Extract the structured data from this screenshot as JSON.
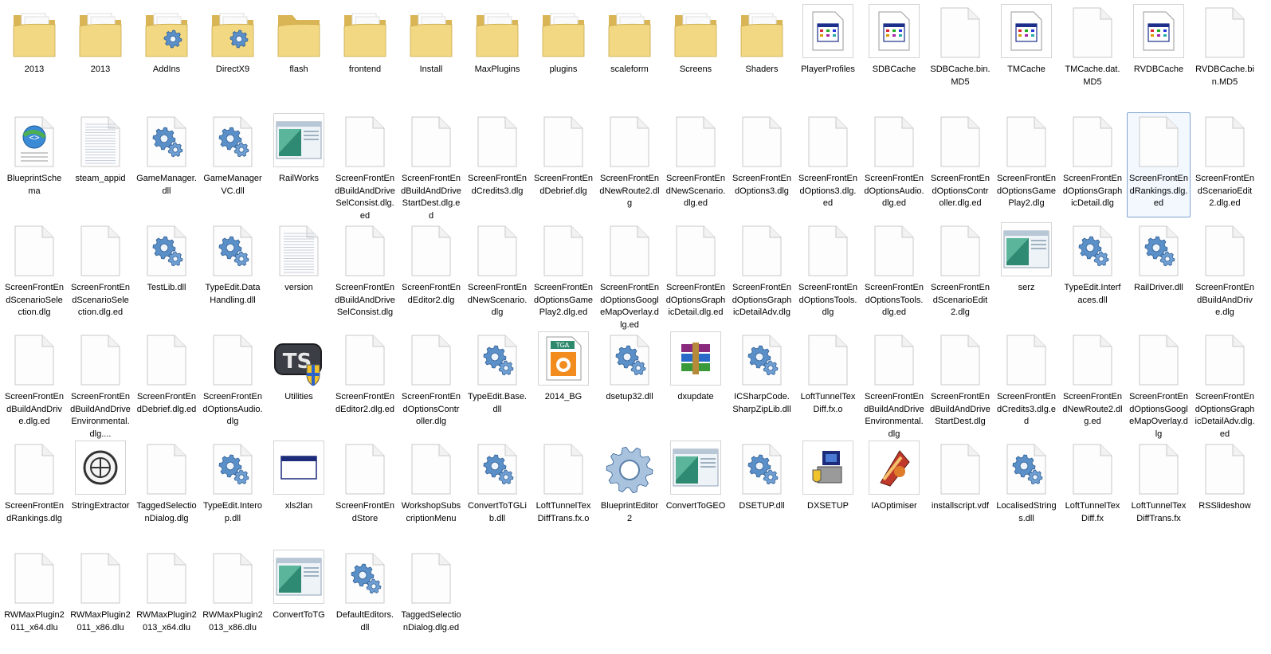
{
  "window": {
    "view": "large-icons"
  },
  "files": [
    {
      "name": "2013",
      "icon": "folder-icon"
    },
    {
      "name": "2013",
      "icon": "folder-icon"
    },
    {
      "name": "AddIns",
      "icon": "folder-gear-icon"
    },
    {
      "name": "DirectX9",
      "icon": "folder-gear-icon"
    },
    {
      "name": "flash",
      "icon": "folder-empty-icon"
    },
    {
      "name": "frontend",
      "icon": "folder-icon"
    },
    {
      "name": "Install",
      "icon": "folder-icon"
    },
    {
      "name": "MaxPlugins",
      "icon": "folder-icon"
    },
    {
      "name": "plugins",
      "icon": "folder-icon"
    },
    {
      "name": "scaleform",
      "icon": "folder-icon"
    },
    {
      "name": "Screens",
      "icon": "folder-icon"
    },
    {
      "name": "Shaders",
      "icon": "folder-icon"
    },
    {
      "name": "PlayerProfiles",
      "icon": "database-file-icon"
    },
    {
      "name": "SDBCache",
      "icon": "database-file-icon"
    },
    {
      "name": "SDBCache.bin.MD5",
      "icon": "blank-file-icon"
    },
    {
      "name": "TMCache",
      "icon": "database-file-icon"
    },
    {
      "name": "TMCache.dat.MD5",
      "icon": "blank-file-icon"
    },
    {
      "name": "RVDBCache",
      "icon": "database-file-icon"
    },
    {
      "name": "RVDBCache.bin.MD5",
      "icon": "blank-file-icon"
    },
    {
      "name": "BlueprintSchema",
      "icon": "xml-schema-icon"
    },
    {
      "name": "steam_appid",
      "icon": "text-file-icon"
    },
    {
      "name": "GameManager.dll",
      "icon": "dll-gear-icon"
    },
    {
      "name": "GameManagerVC.dll",
      "icon": "dll-gear-icon"
    },
    {
      "name": "RailWorks",
      "icon": "application-window-icon"
    },
    {
      "name": "ScreenFrontEndBuildAndDriveSelConsist.dlg.ed",
      "icon": "blank-file-icon"
    },
    {
      "name": "ScreenFrontEndBuildAndDriveStartDest.dlg.ed",
      "icon": "blank-file-icon"
    },
    {
      "name": "ScreenFrontEndCredits3.dlg",
      "icon": "blank-file-icon"
    },
    {
      "name": "ScreenFrontEndDebrief.dlg",
      "icon": "blank-file-icon"
    },
    {
      "name": "ScreenFrontEndNewRoute2.dlg",
      "icon": "blank-file-icon"
    },
    {
      "name": "ScreenFrontEndNewScenario.dlg.ed",
      "icon": "blank-file-icon"
    },
    {
      "name": "ScreenFrontEndOptions3.dlg",
      "icon": "blank-file-icon"
    },
    {
      "name": "ScreenFrontEndOptions3.dlg.ed",
      "icon": "blank-file-icon"
    },
    {
      "name": "ScreenFrontEndOptionsAudio.dlg.ed",
      "icon": "blank-file-icon"
    },
    {
      "name": "ScreenFrontEndOptionsController.dlg.ed",
      "icon": "blank-file-icon"
    },
    {
      "name": "ScreenFrontEndOptionsGamePlay2.dlg",
      "icon": "blank-file-icon"
    },
    {
      "name": "ScreenFrontEndOptionsGraphicDetail.dlg",
      "icon": "blank-file-icon"
    },
    {
      "name": "ScreenFrontEndRankings.dlg.ed",
      "icon": "blank-file-icon",
      "selected": true
    },
    {
      "name": "ScreenFrontEndScenarioEdit2.dlg.ed",
      "icon": "blank-file-icon"
    },
    {
      "name": "ScreenFrontEndScenarioSelection.dlg",
      "icon": "blank-file-icon"
    },
    {
      "name": "ScreenFrontEndScenarioSelection.dlg.ed",
      "icon": "blank-file-icon"
    },
    {
      "name": "TestLib.dll",
      "icon": "dll-gear-icon"
    },
    {
      "name": "TypeEdit.DataHandling.dll",
      "icon": "dll-gear-icon"
    },
    {
      "name": "version",
      "icon": "text-file-icon"
    },
    {
      "name": "ScreenFrontEndBuildAndDriveSelConsist.dlg",
      "icon": "blank-file-icon"
    },
    {
      "name": "ScreenFrontEndEditor2.dlg",
      "icon": "blank-file-icon"
    },
    {
      "name": "ScreenFrontEndNewScenario.dlg",
      "icon": "blank-file-icon"
    },
    {
      "name": "ScreenFrontEndOptionsGamePlay2.dlg.ed",
      "icon": "blank-file-icon"
    },
    {
      "name": "ScreenFrontEndOptionsGoogleMapOverlay.dlg.ed",
      "icon": "blank-file-icon"
    },
    {
      "name": "ScreenFrontEndOptionsGraphicDetail.dlg.ed",
      "icon": "blank-file-icon"
    },
    {
      "name": "ScreenFrontEndOptionsGraphicDetailAdv.dlg",
      "icon": "blank-file-icon"
    },
    {
      "name": "ScreenFrontEndOptionsTools.dlg",
      "icon": "blank-file-icon"
    },
    {
      "name": "ScreenFrontEndOptionsTools.dlg.ed",
      "icon": "blank-file-icon"
    },
    {
      "name": "ScreenFrontEndScenarioEdit2.dlg",
      "icon": "blank-file-icon"
    },
    {
      "name": "serz",
      "icon": "application-window-icon"
    },
    {
      "name": "TypeEdit.Interfaces.dll",
      "icon": "dll-gear-icon"
    },
    {
      "name": "RailDriver.dll",
      "icon": "dll-gear-icon"
    },
    {
      "name": "ScreenFrontEndBuildAndDrive.dlg",
      "icon": "blank-file-icon"
    },
    {
      "name": "ScreenFrontEndBuildAndDrive.dlg.ed",
      "icon": "blank-file-icon"
    },
    {
      "name": "ScreenFrontEndBuildAndDriveEnvironmental.dlg....",
      "icon": "blank-file-icon"
    },
    {
      "name": "ScreenFrontEndDebrief.dlg.ed",
      "icon": "blank-file-icon"
    },
    {
      "name": "ScreenFrontEndOptionsAudio.dlg",
      "icon": "blank-file-icon"
    },
    {
      "name": "Utilities",
      "icon": "ts-shield-icon"
    },
    {
      "name": "ScreenFrontEndEditor2.dlg.ed",
      "icon": "blank-file-icon"
    },
    {
      "name": "ScreenFrontEndOptionsController.dlg",
      "icon": "blank-file-icon"
    },
    {
      "name": "TypeEdit.Base.dll",
      "icon": "dll-gear-icon"
    },
    {
      "name": "2014_BG",
      "icon": "tga-image-icon"
    },
    {
      "name": "dsetup32.dll",
      "icon": "dll-gear-icon"
    },
    {
      "name": "dxupdate",
      "icon": "winrar-archive-icon"
    },
    {
      "name": "ICSharpCode.SharpZipLib.dll",
      "icon": "dll-gear-icon"
    },
    {
      "name": "LoftTunnelTexDiff.fx.o",
      "icon": "blank-file-icon"
    },
    {
      "name": "ScreenFrontEndBuildAndDriveEnvironmental.dlg",
      "icon": "blank-file-icon"
    },
    {
      "name": "ScreenFrontEndBuildAndDriveStartDest.dlg",
      "icon": "blank-file-icon"
    },
    {
      "name": "ScreenFrontEndCredits3.dlg.ed",
      "icon": "blank-file-icon"
    },
    {
      "name": "ScreenFrontEndNewRoute2.dlg.ed",
      "icon": "blank-file-icon"
    },
    {
      "name": "ScreenFrontEndOptionsGoogleMapOverlay.dlg",
      "icon": "blank-file-icon"
    },
    {
      "name": "ScreenFrontEndOptionsGraphicDetailAdv.dlg.ed",
      "icon": "blank-file-icon"
    },
    {
      "name": "ScreenFrontEndRankings.dlg",
      "icon": "blank-file-icon"
    },
    {
      "name": "StringExtractor",
      "icon": "string-extractor-icon"
    },
    {
      "name": "TaggedSelectionDialog.dlg",
      "icon": "blank-file-icon"
    },
    {
      "name": "TypeEdit.Interop.dll",
      "icon": "dll-gear-icon"
    },
    {
      "name": "xls2lan",
      "icon": "console-window-icon"
    },
    {
      "name": "ScreenFrontEndStore",
      "icon": "blank-file-icon"
    },
    {
      "name": "WorkshopSubscriptionMenu",
      "icon": "blank-file-icon"
    },
    {
      "name": "ConvertToTGLib.dll",
      "icon": "dll-gear-icon"
    },
    {
      "name": "LoftTunnelTexDiffTrans.fx.o",
      "icon": "blank-file-icon"
    },
    {
      "name": "BlueprintEditor2",
      "icon": "big-gear-icon"
    },
    {
      "name": "ConvertToGEO",
      "icon": "application-window-icon"
    },
    {
      "name": "DSETUP.dll",
      "icon": "dll-gear-icon"
    },
    {
      "name": "DXSETUP",
      "icon": "dx-setup-icon"
    },
    {
      "name": "IAOptimiser",
      "icon": "ia-optimiser-icon"
    },
    {
      "name": "installscript.vdf",
      "icon": "blank-file-icon"
    },
    {
      "name": "LocalisedStrings.dll",
      "icon": "dll-gear-icon"
    },
    {
      "name": "LoftTunnelTexDiff.fx",
      "icon": "blank-file-icon"
    },
    {
      "name": "LoftTunnelTexDiffTrans.fx",
      "icon": "blank-file-icon"
    },
    {
      "name": "RSSlideshow",
      "icon": "blank-file-icon"
    },
    {
      "name": "RWMaxPlugin2011_x64.dlu",
      "icon": "blank-file-icon"
    },
    {
      "name": "RWMaxPlugin2011_x86.dlu",
      "icon": "blank-file-icon"
    },
    {
      "name": "RWMaxPlugin2013_x64.dlu",
      "icon": "blank-file-icon"
    },
    {
      "name": "RWMaxPlugin2013_x86.dlu",
      "icon": "blank-file-icon"
    },
    {
      "name": "ConvertToTG",
      "icon": "application-window-icon"
    },
    {
      "name": "DefaultEditors.dll",
      "icon": "dll-gear-icon"
    },
    {
      "name": "TaggedSelectionDialog.dlg.ed",
      "icon": "blank-file-icon"
    }
  ],
  "colors": {
    "folder": "#f3d883",
    "folder_dark": "#d9b555",
    "gear": "#5a8fc8",
    "selection_border": "#7da2ce",
    "tile_border": "#d4d4d4"
  }
}
